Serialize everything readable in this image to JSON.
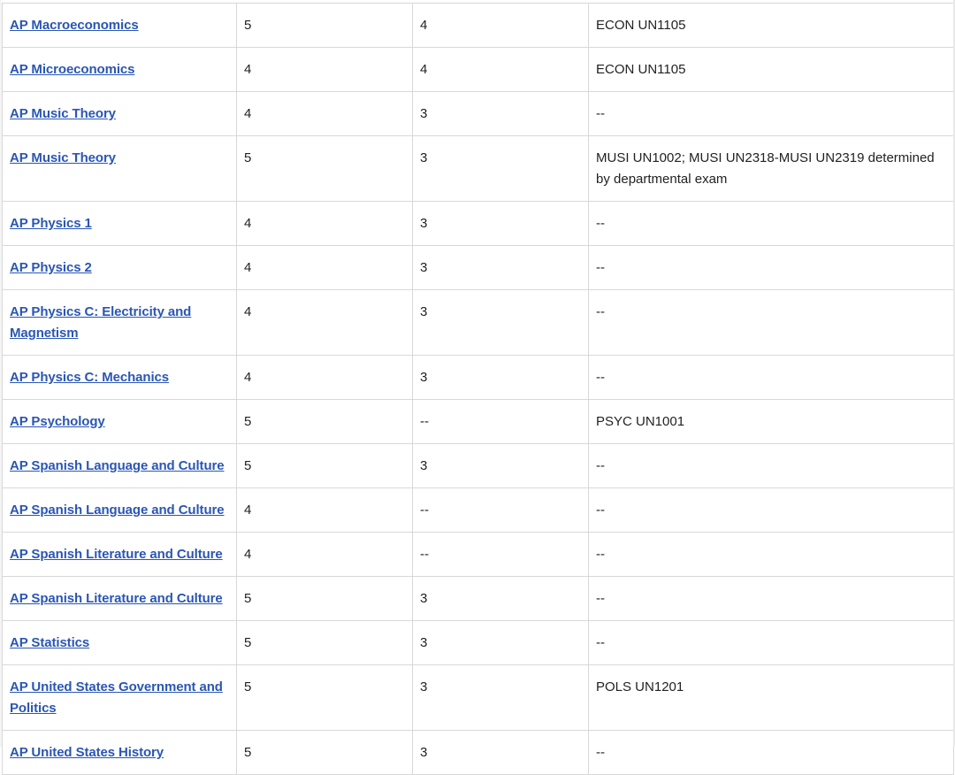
{
  "table": {
    "rows": [
      {
        "exam": "AP Macroeconomics",
        "score": "5",
        "points": "4",
        "equivalent": "ECON UN1105"
      },
      {
        "exam": "AP Microeconomics",
        "score": "4",
        "points": "4",
        "equivalent": "ECON UN1105"
      },
      {
        "exam": "AP Music Theory",
        "score": "4",
        "points": "3",
        "equivalent": "--"
      },
      {
        "exam": "AP Music Theory",
        "score": "5",
        "points": "3",
        "equivalent": "MUSI UN1002; MUSI UN2318-MUSI UN2319 determined by departmental exam"
      },
      {
        "exam": "AP Physics 1",
        "score": "4",
        "points": "3",
        "equivalent": "--"
      },
      {
        "exam": "AP Physics 2",
        "score": "4",
        "points": "3",
        "equivalent": "--"
      },
      {
        "exam": "AP Physics C: Electricity and Magnetism",
        "score": "4",
        "points": "3",
        "equivalent": "--"
      },
      {
        "exam": "AP Physics C: Mechanics",
        "score": "4",
        "points": "3",
        "equivalent": "--"
      },
      {
        "exam": "AP Psychology",
        "score": "5",
        "points": "--",
        "equivalent": "PSYC UN1001"
      },
      {
        "exam": "AP Spanish Language and Culture",
        "score": "5",
        "points": "3",
        "equivalent": "--"
      },
      {
        "exam": "AP Spanish Language and Culture",
        "score": "4",
        "points": "--",
        "equivalent": "--"
      },
      {
        "exam": "AP Spanish Literature and Culture",
        "score": "4",
        "points": "--",
        "equivalent": "--"
      },
      {
        "exam": "AP Spanish Literature and Culture",
        "score": "5",
        "points": "3",
        "equivalent": "--"
      },
      {
        "exam": "AP Statistics",
        "score": "5",
        "points": "3",
        "equivalent": "--"
      },
      {
        "exam": "AP United States Government and Politics",
        "score": "5",
        "points": "3",
        "equivalent": "POLS UN1201"
      },
      {
        "exam": "AP United States History",
        "score": "5",
        "points": "3",
        "equivalent": "--"
      }
    ]
  },
  "colors": {
    "link": "#2a56b4",
    "text": "#222222",
    "border": "#d8d8d8"
  }
}
